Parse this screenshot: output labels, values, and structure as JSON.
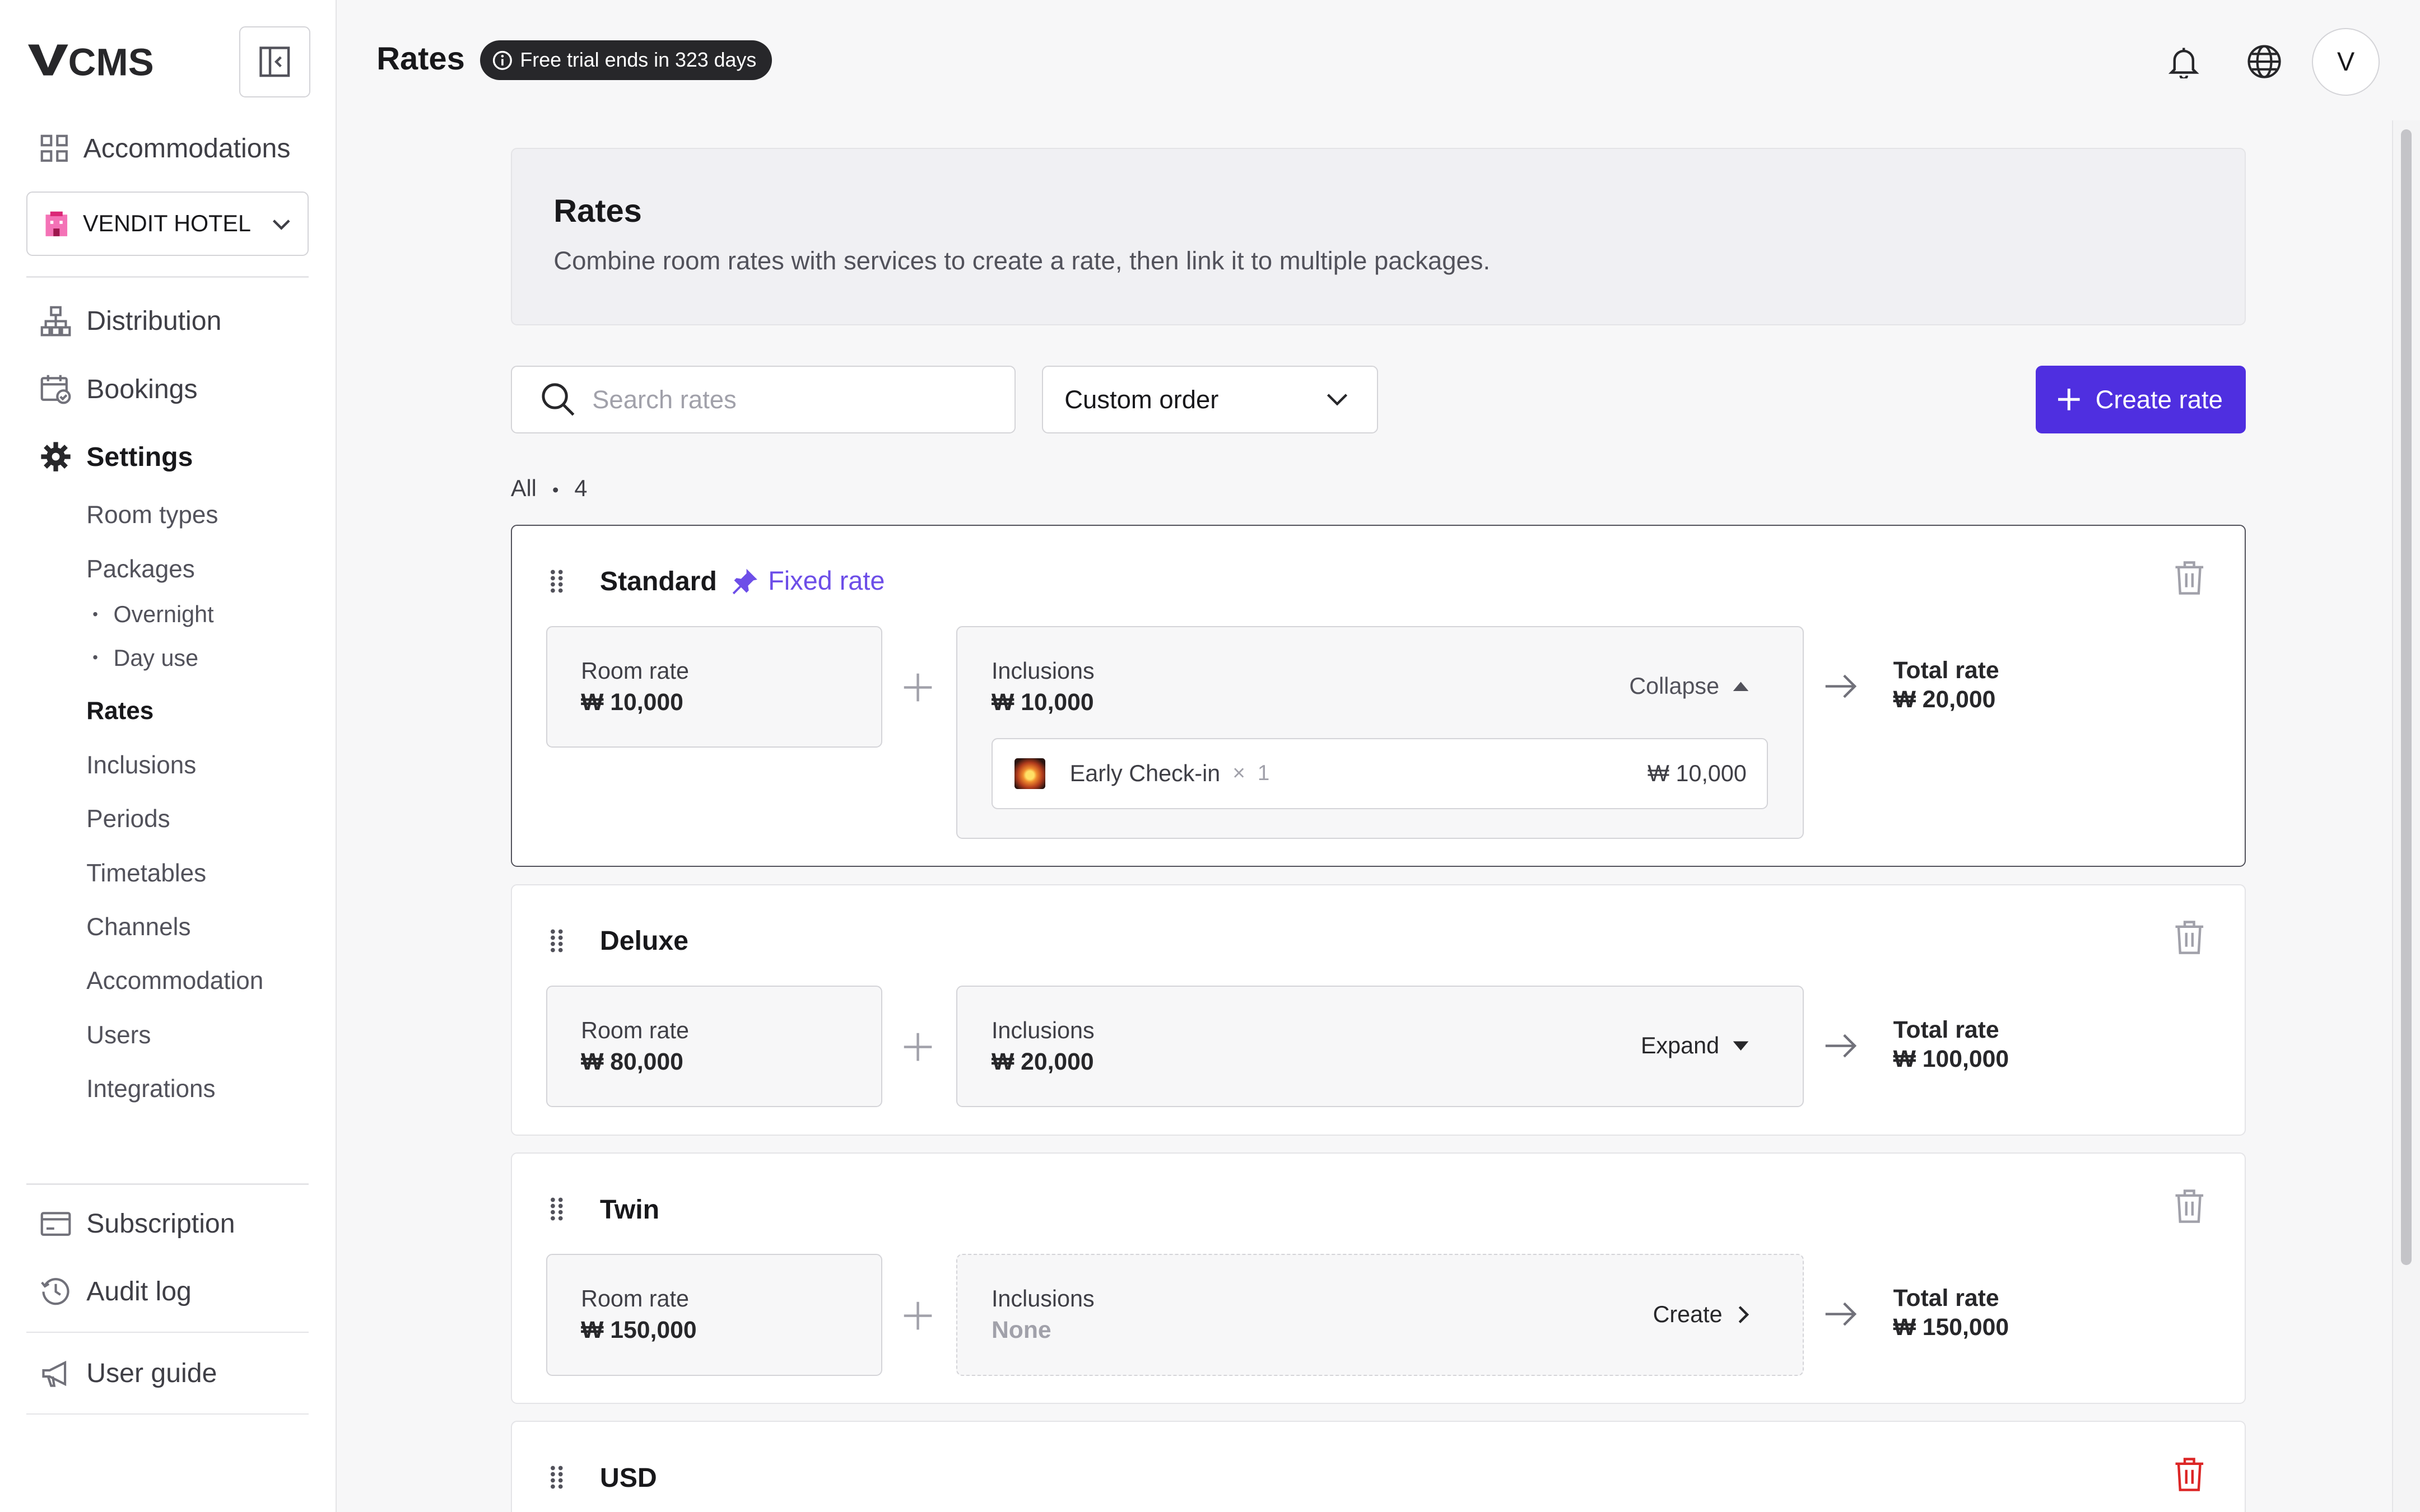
{
  "app": {
    "logo": "VCMS"
  },
  "sidebar": {
    "accommodations": "Accommodations",
    "hotel": "VENDIT HOTEL",
    "items": {
      "distribution": "Distribution",
      "bookings": "Bookings",
      "settings": "Settings"
    },
    "settings_sub": {
      "room_types": "Room types",
      "packages": "Packages",
      "overnight": "Overnight",
      "day_use": "Day use",
      "rates": "Rates",
      "inclusions": "Inclusions",
      "periods": "Periods",
      "timetables": "Timetables",
      "channels": "Channels",
      "accommodation": "Accommodation",
      "users": "Users",
      "integrations": "Integrations"
    },
    "bottom": {
      "subscription": "Subscription",
      "audit_log": "Audit log",
      "user_guide": "User guide"
    }
  },
  "header": {
    "title": "Rates",
    "trial_badge": "Free trial ends in 323 days",
    "avatar_initial": "V"
  },
  "intro": {
    "title": "Rates",
    "description": "Combine room rates with services to create a rate, then link it to multiple packages."
  },
  "toolbar": {
    "search_placeholder": "Search rates",
    "order_value": "Custom order",
    "create_label": "Create rate"
  },
  "count": {
    "label": "All",
    "sep": "•",
    "value": "4"
  },
  "labels": {
    "room_rate": "Room rate",
    "inclusions": "Inclusions",
    "total_rate": "Total rate"
  },
  "rates": [
    {
      "name": "Standard",
      "tag": "Fixed rate",
      "room_rate": "₩ 10,000",
      "inclusions": "₩ 10,000",
      "action": "Collapse",
      "total": "₩ 20,000",
      "item": {
        "name": "Early Check-in",
        "times": "×",
        "qty": "1",
        "price": "₩ 10,000"
      }
    },
    {
      "name": "Deluxe",
      "room_rate": "₩ 80,000",
      "inclusions": "₩ 20,000",
      "action": "Expand",
      "total": "₩ 100,000"
    },
    {
      "name": "Twin",
      "room_rate": "₩ 150,000",
      "inclusions": "None",
      "action": "Create",
      "total": "₩ 150,000"
    },
    {
      "name": "USD",
      "trash_color": "#dc2626"
    }
  ],
  "colors": {
    "accent": "#4f2fe0",
    "fixed_rate": "#6d4ee8",
    "danger": "#dc2626"
  }
}
